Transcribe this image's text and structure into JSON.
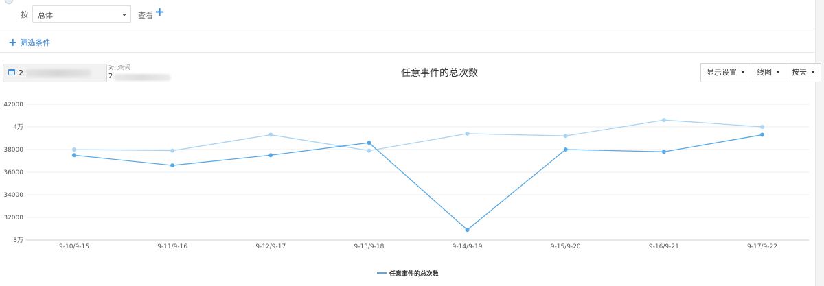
{
  "toolbar": {
    "by_label": "按",
    "group_select": "总体",
    "view_label": "查看",
    "add_symbol": "+"
  },
  "filter": {
    "add_label": "筛选条件"
  },
  "date": {
    "range_prefix": "2",
    "compare_label": "对比时间:",
    "compare_prefix": "2"
  },
  "title": "任意事件的总次数",
  "controls": {
    "display_settings": "显示设置",
    "chart_type": "线图",
    "granularity": "按天"
  },
  "legend": {
    "label": "任意事件的总次数"
  },
  "colors": {
    "primary": "#58a9e6",
    "compare": "#a9d4f2",
    "accent": "#3d8ee0"
  },
  "chart_data": {
    "type": "line",
    "categories": [
      "9-10/9-15",
      "9-11/9-16",
      "9-12/9-17",
      "9-13/9-18",
      "9-14/9-19",
      "9-15/9-20",
      "9-16/9-21",
      "9-17/9-22"
    ],
    "series": [
      {
        "name": "任意事件的总次数",
        "values": [
          37500,
          36600,
          37500,
          38600,
          30900,
          38000,
          37800,
          39300
        ]
      },
      {
        "values": [
          38000,
          37900,
          39300,
          37900,
          39400,
          39200,
          40600,
          40000
        ]
      }
    ],
    "ylim": [
      30000,
      42000
    ],
    "y_ticks": [
      {
        "value": 42000,
        "label": "42000"
      },
      {
        "value": 40000,
        "label": "4万"
      },
      {
        "value": 38000,
        "label": "38000"
      },
      {
        "value": 36000,
        "label": "36000"
      },
      {
        "value": 34000,
        "label": "34000"
      },
      {
        "value": 32000,
        "label": "32000"
      },
      {
        "value": 30000,
        "label": "3万"
      }
    ],
    "grid": true,
    "legend_position": "bottom-center"
  }
}
